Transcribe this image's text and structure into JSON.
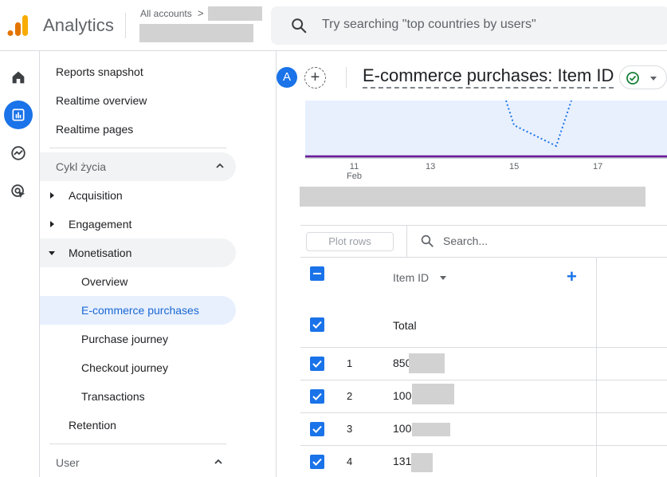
{
  "topbar": {
    "brand": "Analytics",
    "accounts_label": "All accounts",
    "accounts_chevron": ">",
    "search_placeholder": "Try searching \"top countries by users\""
  },
  "rail": {
    "icons": [
      "home-icon",
      "reports-icon",
      "explore-icon",
      "advertising-icon"
    ],
    "active": "reports-icon"
  },
  "sidebar": {
    "top_items": [
      "Reports snapshot",
      "Realtime overview",
      "Realtime pages"
    ],
    "lifecycle_section": "Cykl życia",
    "groups": {
      "acquisition": "Acquisition",
      "engagement": "Engagement",
      "monetisation": "Monetisation",
      "retention": "Retention"
    },
    "monetisation_items": [
      "Overview",
      "E-commerce purchases",
      "Purchase journey",
      "Checkout journey",
      "Transactions"
    ],
    "active_item": "E-commerce purchases",
    "user_section": "User"
  },
  "main": {
    "avatar_letter": "A",
    "add_comparison": "+",
    "report_title": "E-commerce purchases: Item ID",
    "chart_ticks": [
      {
        "label": "11",
        "sub": "Feb"
      },
      {
        "label": "13",
        "sub": ""
      },
      {
        "label": "15",
        "sub": ""
      },
      {
        "label": "17",
        "sub": ""
      }
    ],
    "table": {
      "plot_rows_label": "Plot rows",
      "search_placeholder": "Search...",
      "dimension_header": "Item ID",
      "add_dimension": "+",
      "total_label": "Total",
      "rows": [
        {
          "num": "1",
          "id_prefix": "850"
        },
        {
          "num": "2",
          "id_prefix": "100"
        },
        {
          "num": "3",
          "id_prefix": "100"
        },
        {
          "num": "4",
          "id_prefix": "131"
        }
      ]
    }
  },
  "colors": {
    "accent": "#1a73e8",
    "logo_orange": "#f9ab00",
    "logo_dark_orange": "#e37400",
    "chart_fill": "#e8f0fe",
    "chart_line_purple": "#6a1b9a",
    "active_bg": "#e8f0fe",
    "status_green": "#188038"
  }
}
